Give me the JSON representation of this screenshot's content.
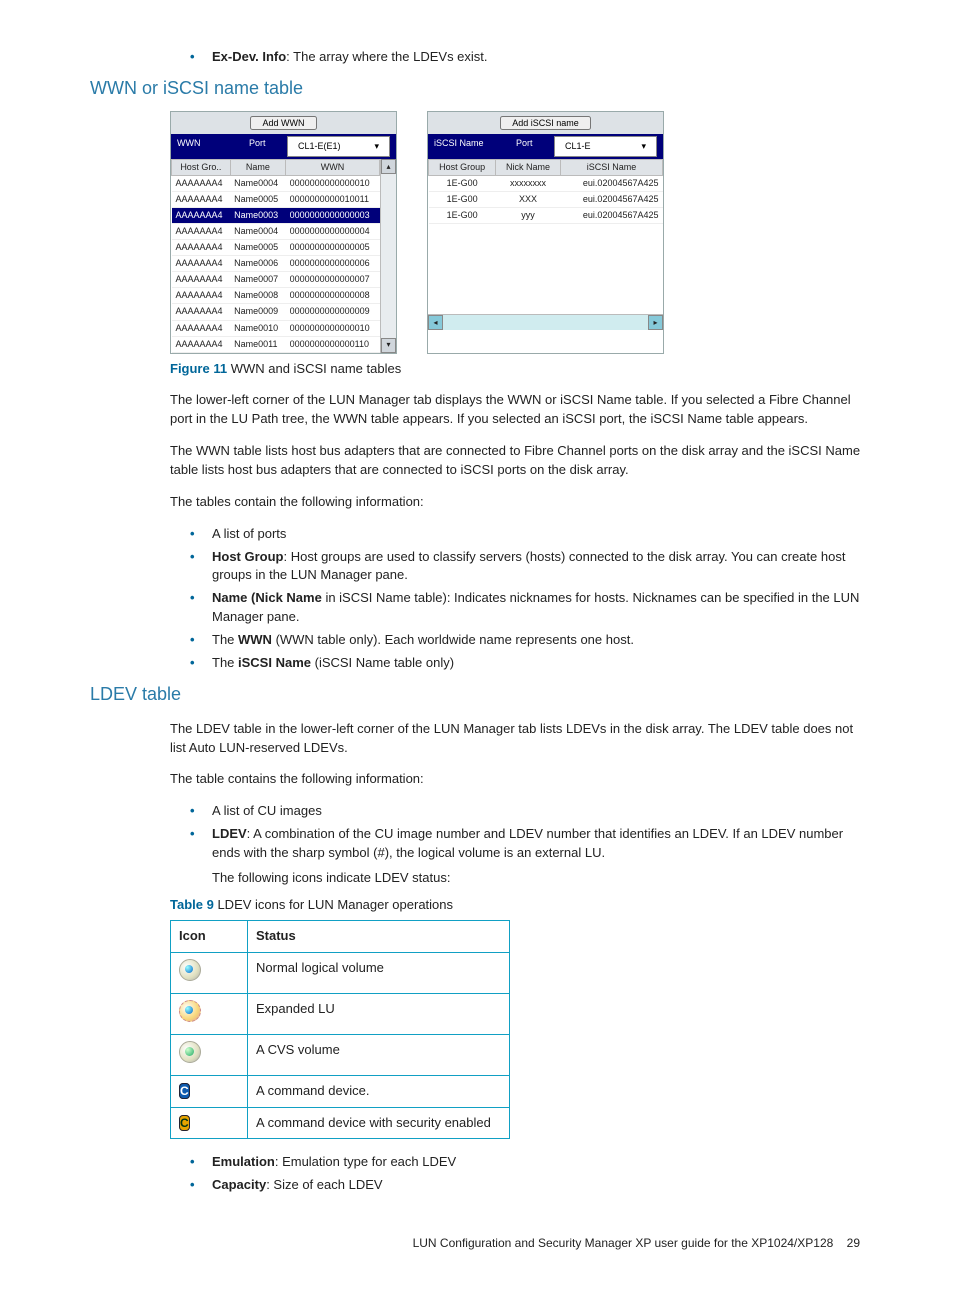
{
  "top_bullet_label": "Ex-Dev. Info",
  "top_bullet_text": ": The array where the LDEVs exist.",
  "h_wwn": "WWN or iSCSI name table",
  "fig": {
    "wwn_add_btn": "Add WWN",
    "iscsi_add_btn": "Add iSCSI name",
    "wwn_title": "WWN",
    "iscsi_title": "iSCSI Name",
    "port_label": "Port",
    "wwn_port_value": "CL1-E(E1)",
    "iscsi_port_value": "CL1-E",
    "wwn_cols": [
      "Host Gro..",
      "Name",
      "WWN"
    ],
    "iscsi_cols": [
      "Host Group",
      "Nick Name",
      "iSCSI Name"
    ],
    "wwn_rows": [
      {
        "hg": "AAAAAAA4",
        "name": "Name0004",
        "wwn": "0000000000000010",
        "sel": false
      },
      {
        "hg": "AAAAAAA4",
        "name": "Name0005",
        "wwn": "0000000000010011",
        "sel": false
      },
      {
        "hg": "AAAAAAA4",
        "name": "Name0003",
        "wwn": "0000000000000003",
        "sel": true
      },
      {
        "hg": "AAAAAAA4",
        "name": "Name0004",
        "wwn": "0000000000000004",
        "sel": false
      },
      {
        "hg": "AAAAAAA4",
        "name": "Name0005",
        "wwn": "0000000000000005",
        "sel": false
      },
      {
        "hg": "AAAAAAA4",
        "name": "Name0006",
        "wwn": "0000000000000006",
        "sel": false
      },
      {
        "hg": "AAAAAAA4",
        "name": "Name0007",
        "wwn": "0000000000000007",
        "sel": false
      },
      {
        "hg": "AAAAAAA4",
        "name": "Name0008",
        "wwn": "0000000000000008",
        "sel": false
      },
      {
        "hg": "AAAAAAA4",
        "name": "Name0009",
        "wwn": "0000000000000009",
        "sel": false
      },
      {
        "hg": "AAAAAAA4",
        "name": "Name0010",
        "wwn": "0000000000000010",
        "sel": false
      },
      {
        "hg": "AAAAAAA4",
        "name": "Name0011",
        "wwn": "0000000000000110",
        "sel": false
      }
    ],
    "iscsi_rows": [
      {
        "hg": "1E-G00",
        "nick": "xxxxxxxx",
        "iname": "eui.02004567A425"
      },
      {
        "hg": "1E-G00",
        "nick": "XXX",
        "iname": "eui.02004567A425"
      },
      {
        "hg": "1E-G00",
        "nick": "yyy",
        "iname": "eui.02004567A425"
      }
    ]
  },
  "fig_caption_label": "Figure 11",
  "fig_caption_text": " WWN and iSCSI name tables",
  "p1": "The lower-left corner of the LUN Manager tab displays the WWN or iSCSI Name table. If you selected a Fibre Channel port in the LU Path tree, the WWN table appears. If you selected an iSCSI port, the iSCSI Name table appears.",
  "p2": "The WWN table lists host bus adapters that are connected to Fibre Channel ports on the disk array and the iSCSI Name table lists host bus adapters that are connected to iSCSI ports on the disk array.",
  "p3": "The tables contain the following information:",
  "bl1": {
    "a": "A list of ports",
    "b_label": "Host Group",
    "b_text": ": Host groups are used to classify servers (hosts) connected to the disk array. You can create host groups in the LUN Manager pane.",
    "c_label": "Name (Nick Name",
    "c_text": " in iSCSI Name table): Indicates nicknames for hosts. Nicknames can be specified in the LUN Manager pane.",
    "d_pre": "The ",
    "d_label": "WWN",
    "d_text": " (WWN table only). Each worldwide name represents one host.",
    "e_pre": "The ",
    "e_label": "iSCSI Name",
    "e_text": " (iSCSI Name table only)"
  },
  "h_ldev": "LDEV table",
  "p4": "The LDEV table in the lower-left corner of the LUN Manager tab lists LDEVs in the disk array. The LDEV table does not list Auto LUN-reserved LDEVs.",
  "p5": "The table contains the following information:",
  "bl2": {
    "a": "A list of CU images",
    "b_label": "LDEV",
    "b_text": ": A combination of the CU image number and LDEV number that identifies an LDEV. If an LDEV number ends with the sharp symbol (#), the logical volume is an external LU.",
    "b_follow": "The following icons indicate LDEV status:"
  },
  "tbl_caption_label": "Table 9",
  "tbl_caption_text": "  LDEV icons for LUN Manager operations",
  "tbl_h1": "Icon",
  "tbl_h2": "Status",
  "tbl_rows": {
    "r1": "Normal logical volume",
    "r2": "Expanded LU",
    "r3": "A CVS volume",
    "r4": "A command device.",
    "r5": "A command device with security enabled"
  },
  "bl3": {
    "a_label": "Emulation",
    "a_text": ": Emulation type for each LDEV",
    "b_label": "Capacity",
    "b_text": ": Size of each LDEV"
  },
  "footer_text": "LUN Configuration and Security Manager XP user guide for the XP1024/XP128",
  "footer_page": "29"
}
